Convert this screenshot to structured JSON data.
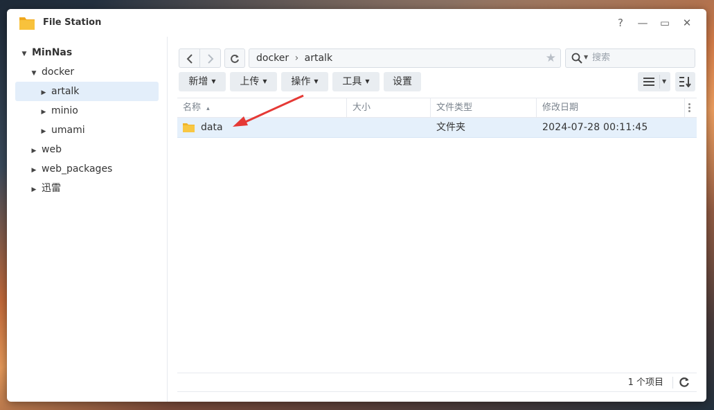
{
  "window": {
    "title": "File Station",
    "controls": {
      "help": "?",
      "minimize": "—",
      "maximize": "▭",
      "close": "✕"
    }
  },
  "sidebar": {
    "items": [
      {
        "label": "MinNas",
        "level": 0,
        "expanded": true,
        "bold": true
      },
      {
        "label": "docker",
        "level": 1,
        "expanded": true
      },
      {
        "label": "artalk",
        "level": 2,
        "expanded": false,
        "selected": true
      },
      {
        "label": "minio",
        "level": 2,
        "expanded": false
      },
      {
        "label": "umami",
        "level": 2,
        "expanded": false
      },
      {
        "label": "web",
        "level": 1,
        "expanded": false
      },
      {
        "label": "web_packages",
        "level": 1,
        "expanded": false
      },
      {
        "label": "迅雷",
        "level": 1,
        "expanded": false
      }
    ]
  },
  "path": {
    "segments": [
      "docker",
      "artalk"
    ],
    "separator": "›",
    "star": "★"
  },
  "search": {
    "placeholder": "搜索"
  },
  "toolbar": {
    "new_label": "新增",
    "upload_label": "上传",
    "action_label": "操作",
    "tools_label": "工具",
    "settings_label": "设置"
  },
  "grid": {
    "columns": [
      "名称",
      "大小",
      "文件类型",
      "修改日期"
    ],
    "sort_indicator": "▴",
    "rows": [
      {
        "name": "data",
        "size": "",
        "type": "文件夹",
        "modified": "2024-07-28 00:11:45"
      }
    ]
  },
  "status": {
    "count_text": "1 个项目"
  },
  "colors": {
    "accent": "#2f6fd6",
    "selected_bg": "#e3eefa",
    "folder": "#f6c343",
    "arrow": "#e53935"
  }
}
